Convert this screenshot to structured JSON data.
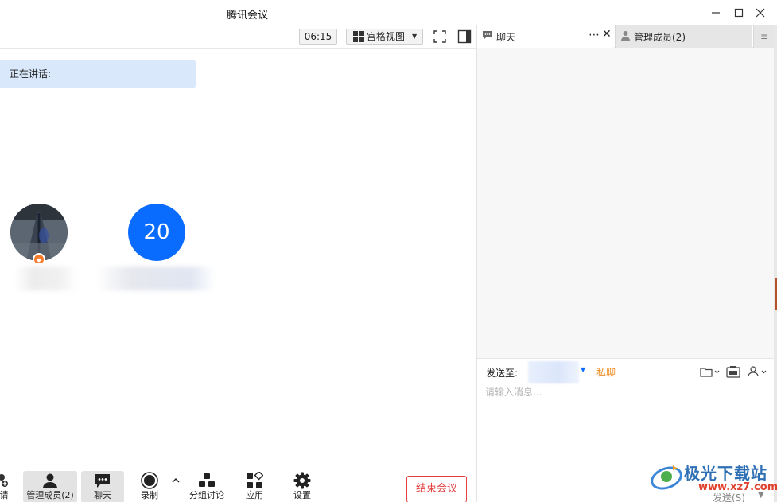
{
  "window": {
    "title": "腾讯会议",
    "min_icon": "minimize-icon",
    "max_icon": "maximize-icon",
    "close_icon": "close-icon"
  },
  "toolbar": {
    "timer": "06:15",
    "view_label": "宫格视图",
    "view_icon": "grid-icon",
    "fullscreen_icon": "fullscreen-icon",
    "sidebar_icon": "sidebar-icon"
  },
  "main": {
    "speaking_label": "正在讲话:",
    "participants": [
      {
        "type": "photo",
        "badge": "host-icon"
      },
      {
        "type": "number",
        "label": "20"
      }
    ]
  },
  "bottombar": {
    "items": [
      {
        "label": "请",
        "icon": "invite-icon"
      },
      {
        "label": "管理成员(2)",
        "icon": "members-icon",
        "active": true
      },
      {
        "label": "聊天",
        "icon": "chat-icon",
        "active": true
      },
      {
        "label": "录制",
        "icon": "record-icon"
      },
      {
        "label": "分组讨论",
        "icon": "breakout-icon"
      },
      {
        "label": "应用",
        "icon": "apps-icon"
      },
      {
        "label": "设置",
        "icon": "settings-icon"
      }
    ],
    "end_label": "结束会议"
  },
  "rpanel": {
    "chat_tab": "聊天",
    "members_tab": "管理成员(2)",
    "compose": {
      "send_to": "发送至:",
      "private": "私聊",
      "placeholder": "请输入消息...",
      "send_label": "发送(S)"
    }
  },
  "watermark": {
    "text": "极光下载站",
    "url": "www.xz7.com"
  },
  "colors": {
    "accent": "#0a6cff",
    "end": "#e34141",
    "private": "#f08a1e",
    "speaking_bg": "#d9e8fb"
  }
}
